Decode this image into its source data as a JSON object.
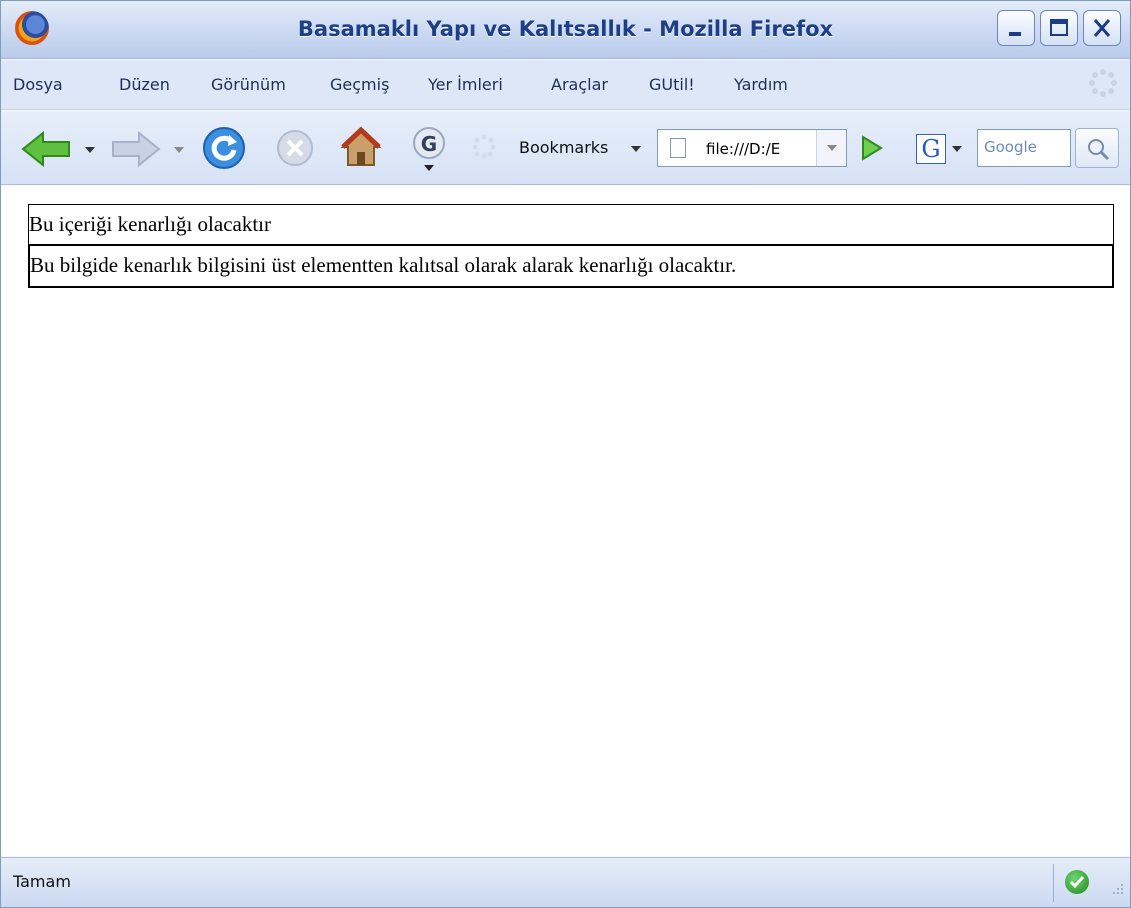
{
  "window": {
    "title": "Basamaklı Yapı ve Kalıtsallık - Mozilla Firefox"
  },
  "menu": [
    {
      "label": "Dosya"
    },
    {
      "label": "Düzen"
    },
    {
      "label": "Görünüm"
    },
    {
      "label": "Geçmiş"
    },
    {
      "label": "Yer İmleri"
    },
    {
      "label": "Araçlar"
    },
    {
      "label": "GUtil!"
    },
    {
      "label": "Yardım"
    }
  ],
  "toolbar": {
    "bookmarks_label": "Bookmarks",
    "url_value": "file:///D:/E",
    "search_placeholder": "Google"
  },
  "content": {
    "outer_text": "Bu içeriği kenarlığı olacaktır",
    "inner_text": "Bu bilgide kenarlık bilgisini üst elementten kalıtsal olarak alarak kenarlığı olacaktır."
  },
  "status": {
    "text": "Tamam"
  }
}
